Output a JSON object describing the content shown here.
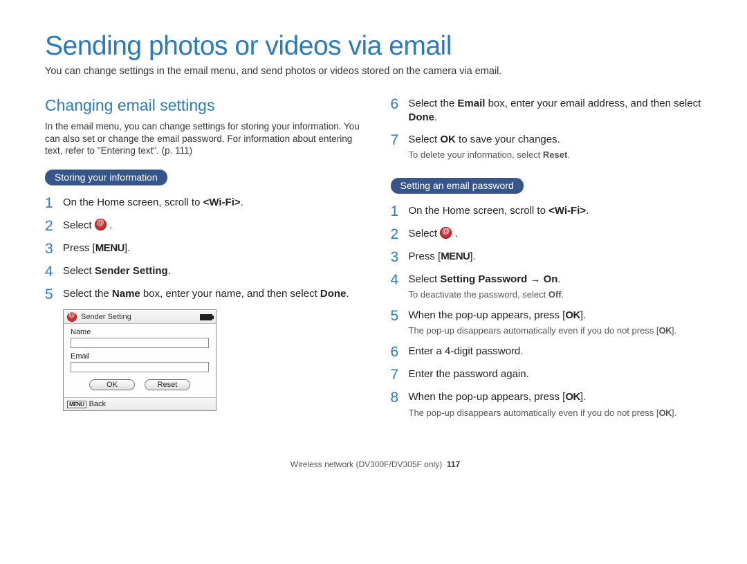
{
  "page": {
    "title": "Sending photos or videos via email",
    "intro": "You can change settings in the email menu, and send photos or videos stored on the camera via email."
  },
  "left": {
    "heading": "Changing email settings",
    "desc": "In the email menu, you can change settings for storing your information. You can also set or change the email password. For information about entering text, refer to \"Entering text\". (p. 111)",
    "pill": "Storing your information",
    "steps": {
      "s1": {
        "pre": "On the Home screen, scroll to ",
        "wifi": "<Wi-Fi>",
        "post": "."
      },
      "s2": {
        "pre": "Select ",
        "post": " ."
      },
      "s3": {
        "pre": "Press [",
        "menu": "MENU",
        "post": "]."
      },
      "s4": {
        "pre": "Select ",
        "b": "Sender Setting",
        "post": "."
      },
      "s5": {
        "a": "Select the ",
        "b1": "Name",
        "c": " box, enter your name, and then select ",
        "b2": "Done",
        "d": "."
      }
    }
  },
  "right_top": {
    "s6": {
      "a": "Select the ",
      "b1": "Email",
      "c": " box, enter your email address, and then select ",
      "b2": "Done",
      "d": "."
    },
    "s7": {
      "a": "Select ",
      "b1": "OK",
      "c": " to save your changes.",
      "sub_a": "To delete your information, select ",
      "sub_b": "Reset",
      "sub_c": "."
    }
  },
  "right": {
    "pill": "Setting an email password",
    "s1": {
      "pre": "On the Home screen, scroll to ",
      "wifi": "<Wi-Fi>",
      "post": "."
    },
    "s2": {
      "pre": "Select ",
      "post": " ."
    },
    "s3": {
      "pre": "Press [",
      "menu": "MENU",
      "post": "]."
    },
    "s4": {
      "a": "Select ",
      "b1": "Setting Password",
      "arrow": " → ",
      "b2": "On",
      "post": ".",
      "sub_a": "To deactivate the password, select ",
      "sub_b": "Off",
      "sub_c": "."
    },
    "s5": {
      "a": "When the pop-up appears, press [",
      "ok": "OK",
      "b": "].",
      "sub_a": "The pop-up disappears automatically even if you do not press [",
      "sub_ok": "OK",
      "sub_b": "]."
    },
    "s6": {
      "text": "Enter a 4-digit password."
    },
    "s7": {
      "text": "Enter the password again."
    },
    "s8": {
      "a": "When the pop-up appears, press [",
      "ok": "OK",
      "b": "].",
      "sub_a": "The pop-up disappears automatically even if you do not press [",
      "sub_ok": "OK",
      "sub_b": "]."
    }
  },
  "camera": {
    "title": "Sender Setting",
    "name_label": "Name",
    "email_label": "Email",
    "ok": "OK",
    "reset": "Reset",
    "menu": "MENU",
    "back": "Back"
  },
  "nums": {
    "n1": "1",
    "n2": "2",
    "n3": "3",
    "n4": "4",
    "n5": "5",
    "n6": "6",
    "n7": "7",
    "n8": "8"
  },
  "footer": {
    "text": "Wireless network (DV300F/DV305F only)",
    "page": "117"
  }
}
